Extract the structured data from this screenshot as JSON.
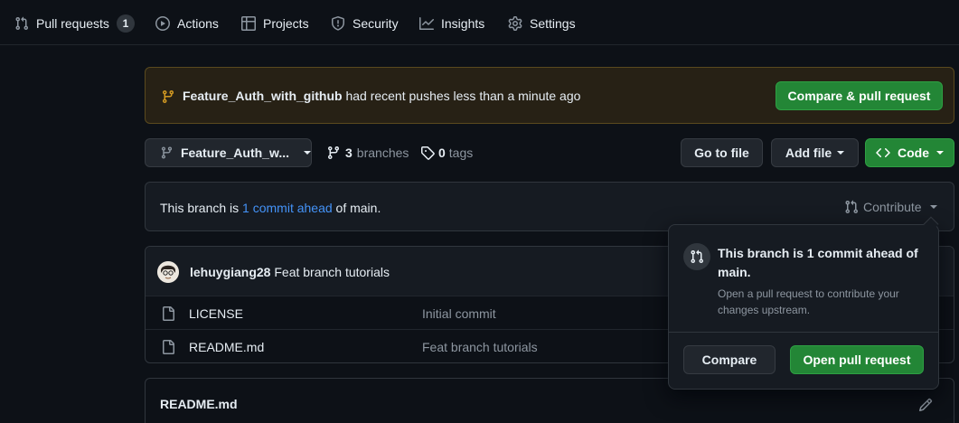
{
  "nav": {
    "pull_requests": "Pull requests",
    "pull_requests_count": "1",
    "actions": "Actions",
    "projects": "Projects",
    "security": "Security",
    "insights": "Insights",
    "settings": "Settings"
  },
  "banner": {
    "branch": "Feature_Auth_with_github",
    "message": "had recent pushes less than a minute ago",
    "button": "Compare & pull request"
  },
  "toolbar": {
    "branch_select": "Feature_Auth_w...",
    "branches_count": "3",
    "branches_label": "branches",
    "tags_count": "0",
    "tags_label": "tags",
    "go_to_file": "Go to file",
    "add_file": "Add file",
    "code": "Code"
  },
  "status": {
    "prefix": "This branch is",
    "link": "1 commit ahead",
    "suffix": "of main.",
    "contribute": "Contribute"
  },
  "commit": {
    "author": "lehuygiang28",
    "message": "Feat branch tutorials"
  },
  "files": [
    {
      "name": "LICENSE",
      "message": "Initial commit"
    },
    {
      "name": "README.md",
      "message": "Feat branch tutorials"
    }
  ],
  "readme": {
    "title": "README.md"
  },
  "popover": {
    "title": "This branch is 1 commit ahead of main.",
    "description": "Open a pull request to contribute your changes upstream.",
    "compare": "Compare",
    "open_pr": "Open pull request"
  },
  "colors": {
    "background": "#0d1117",
    "accent_green": "#238636",
    "link_blue": "#4493f8",
    "banner_icon": "#d29922"
  }
}
